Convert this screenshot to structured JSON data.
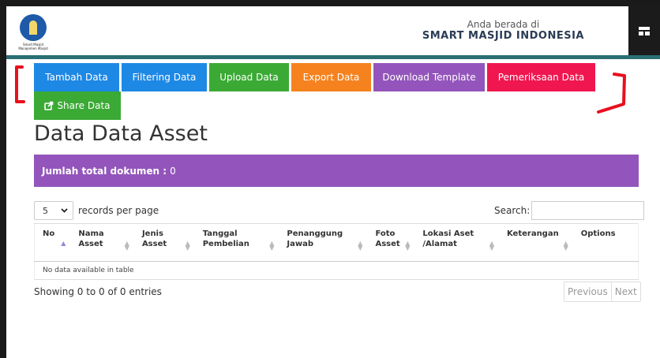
{
  "header": {
    "logo_text": "Smart Masjid Manajemen Masjid",
    "location_prefix": "Anda berada di",
    "location_name": "SMART MASJID INDONESIA"
  },
  "toolbar": {
    "buttons": [
      {
        "label": "Tambah Data",
        "color": "#1e88e5"
      },
      {
        "label": "Filtering Data",
        "color": "#1e88e5"
      },
      {
        "label": "Upload Data",
        "color": "#3aaa35"
      },
      {
        "label": "Export Data",
        "color": "#f5821f"
      },
      {
        "label": "Download Template",
        "color": "#9355bb"
      },
      {
        "label": "Pemeriksaan Data",
        "color": "#f0164f"
      },
      {
        "label": "Share Data",
        "color": "#3aaa35",
        "icon": "share-square-icon"
      }
    ]
  },
  "page": {
    "title": "Data Data Asset"
  },
  "summary": {
    "label": "Jumlah total dokumen :",
    "count": "0",
    "color": "#9355bb"
  },
  "table_controls": {
    "page_size": "5",
    "records_per_page": "records per page",
    "search_label": "Search:",
    "search_value": ""
  },
  "table": {
    "columns": [
      "No",
      "Nama Asset",
      "Jenis Asset",
      "Tanggal Pembelian",
      "Penanggung Jawab",
      "Foto Asset",
      "Lokasi Aset /Alamat",
      "Keterangan",
      "Options"
    ],
    "empty_message": "No data available in table"
  },
  "footer": {
    "info": "Showing 0 to 0 of 0 entries",
    "previous": "Previous",
    "next": "Next"
  },
  "colors": {
    "header_dark": "#1a1a1a",
    "teal_bar": "#2a6f73",
    "annotation_red": "#e8101e"
  }
}
